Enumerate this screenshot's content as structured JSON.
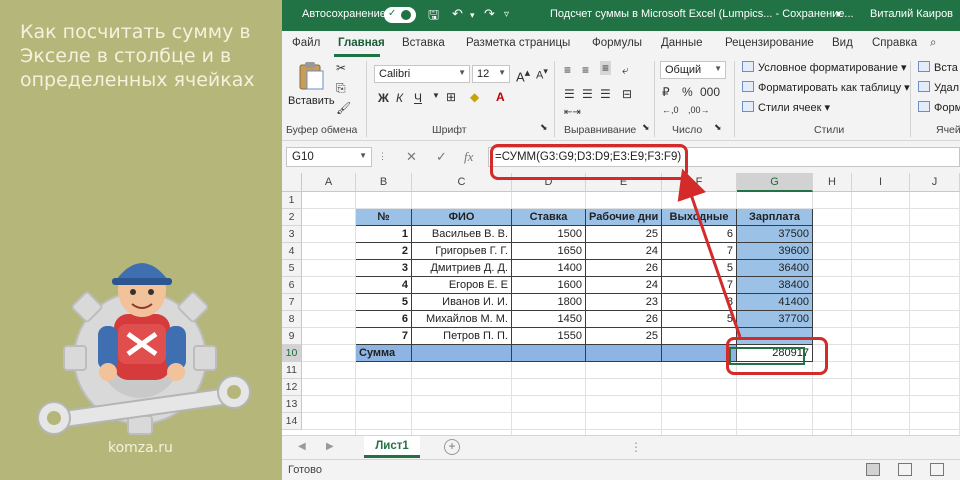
{
  "brand": {
    "title": "Как посчитать сумму в Экселе в столбце и в определенных ячейках",
    "site": "komza.ru"
  },
  "titlebar": {
    "autosave_label": "Автосохранение",
    "doc_title": "Подсчет суммы в Microsoft Excel (Lumpics... - Сохранение...",
    "user": "Виталий Каиров"
  },
  "menu": {
    "items": [
      "Файл",
      "Главная",
      "Вставка",
      "Разметка страницы",
      "Формулы",
      "Данные",
      "Рецензирование",
      "Вид",
      "Справка"
    ],
    "active": "Главная"
  },
  "ribbon": {
    "paste_label": "Вставить",
    "font_name": "Calibri",
    "font_size": "12",
    "number_format": "Общий",
    "conditional_formatting": "Условное форматирование",
    "format_as_table": "Форматировать как таблицу",
    "cell_styles": "Стили ячеек",
    "insert_short": "Вста",
    "delete_short": "Удал",
    "format_short": "Форм",
    "groups": {
      "clipboard": "Буфер обмена",
      "font": "Шрифт",
      "alignment": "Выравнивание",
      "number": "Число",
      "styles": "Стили",
      "cells": "Ячей"
    }
  },
  "formula_bar": {
    "name_box": "G10",
    "fx": "fx",
    "formula": "=СУММ(G3:G9;D3:D9;E3:E9;F3:F9)"
  },
  "grid": {
    "columns": [
      "A",
      "B",
      "C",
      "D",
      "E",
      "F",
      "G",
      "H",
      "I",
      "J"
    ],
    "rows": [
      "1",
      "2",
      "3",
      "4",
      "5",
      "6",
      "7",
      "8",
      "9",
      "10",
      "11",
      "12",
      "13",
      "14"
    ],
    "table": {
      "headers": [
        "№",
        "ФИО",
        "Ставка",
        "Рабочие дни",
        "Выходные",
        "Зарплата"
      ],
      "rows": [
        [
          "1",
          "Васильев В. В.",
          "1500",
          "25",
          "6",
          "37500"
        ],
        [
          "2",
          "Григорьев Г. Г.",
          "1650",
          "24",
          "7",
          "39600"
        ],
        [
          "3",
          "Дмитриев Д. Д.",
          "1400",
          "26",
          "5",
          "36400"
        ],
        [
          "4",
          "Егоров Е. Е",
          "1600",
          "24",
          "7",
          "38400"
        ],
        [
          "5",
          "Иванов И. И.",
          "1800",
          "23",
          "8",
          "41400"
        ],
        [
          "6",
          "Михайлов М. М.",
          "1450",
          "26",
          "5",
          "37700"
        ],
        [
          "7",
          "Петров П. П.",
          "1550",
          "25",
          "",
          ""
        ]
      ],
      "sum_label": "Сумма",
      "sum_value": "280917"
    }
  },
  "sheet_tab": "Лист1",
  "status": "Готово",
  "colors": {
    "excel_green": "#217346",
    "table_blue": "#9bc2e6",
    "highlight_red": "#d42a2a",
    "brand_bg": "#b5b77a"
  }
}
